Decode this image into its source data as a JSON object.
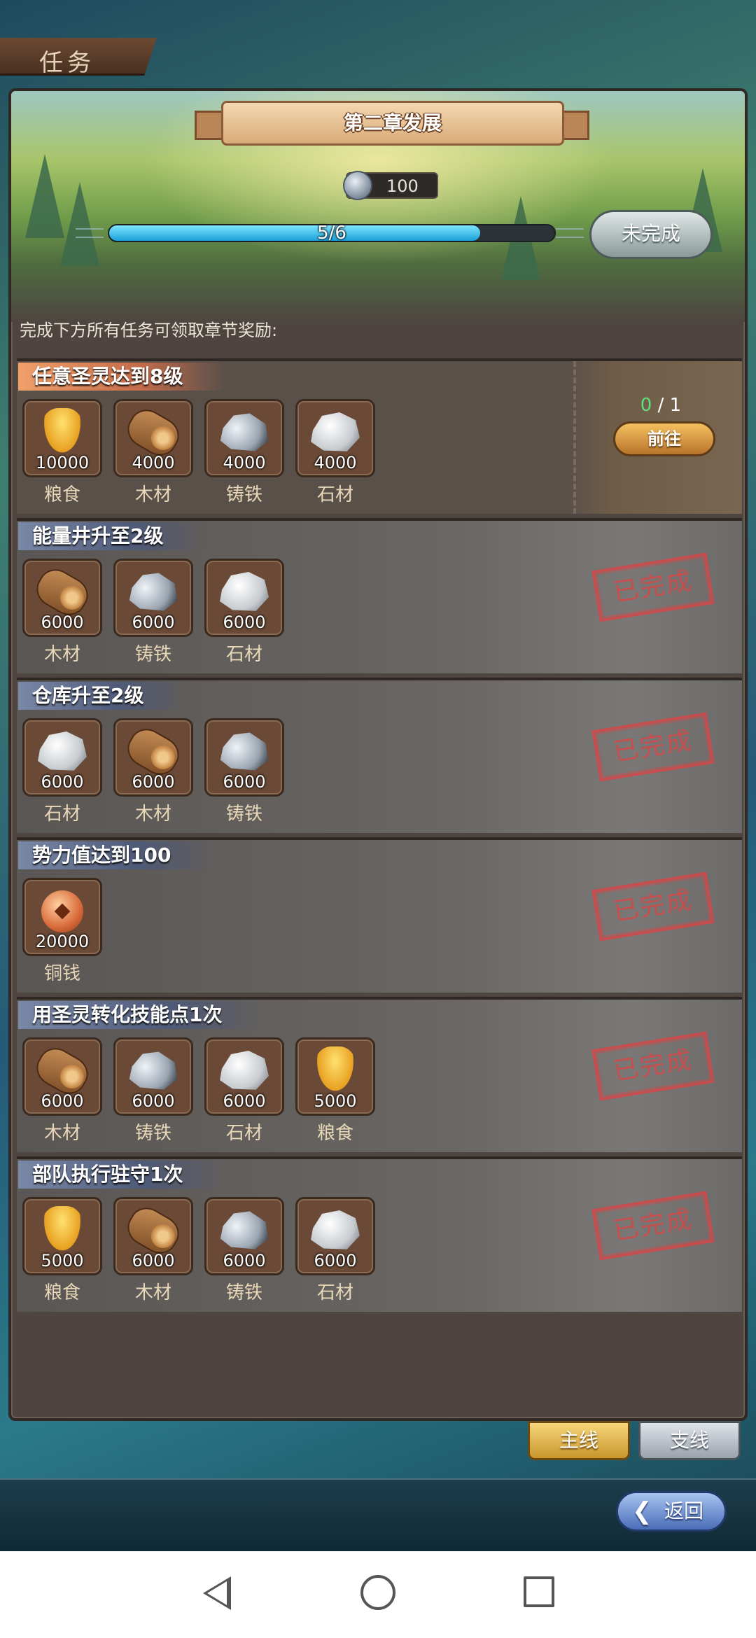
{
  "header": {
    "title": "任务"
  },
  "chapter": {
    "title": "第二章发展",
    "reward_amount": "100",
    "progress_label": "5/6",
    "progress": {
      "current": 5,
      "total": 6
    },
    "status_button": "未完成",
    "hint": "完成下方所有任务可领取章节奖励:"
  },
  "tasks": [
    {
      "title": "任意圣灵达到8级",
      "state": "active",
      "count_current": "0",
      "count_sep": "/",
      "count_total": "1",
      "goto_label": "前往",
      "rewards": [
        {
          "icon": "grain-icon",
          "qty": "10000",
          "name": "粮食"
        },
        {
          "icon": "wood-icon",
          "qty": "4000",
          "name": "木材"
        },
        {
          "icon": "iron-icon",
          "qty": "4000",
          "name": "铸铁"
        },
        {
          "icon": "stone-icon",
          "qty": "4000",
          "name": "石材"
        }
      ]
    },
    {
      "title": "能量井升至2级",
      "state": "done",
      "stamp": "已完成",
      "rewards": [
        {
          "icon": "wood-icon",
          "qty": "6000",
          "name": "木材"
        },
        {
          "icon": "iron-icon",
          "qty": "6000",
          "name": "铸铁"
        },
        {
          "icon": "stone-icon",
          "qty": "6000",
          "name": "石材"
        }
      ]
    },
    {
      "title": "仓库升至2级",
      "state": "done",
      "stamp": "已完成",
      "rewards": [
        {
          "icon": "stone-icon",
          "qty": "6000",
          "name": "石材"
        },
        {
          "icon": "wood-icon",
          "qty": "6000",
          "name": "木材"
        },
        {
          "icon": "iron-icon",
          "qty": "6000",
          "name": "铸铁"
        }
      ]
    },
    {
      "title": "势力值达到100",
      "state": "done",
      "stamp": "已完成",
      "rewards": [
        {
          "icon": "copper-coin-icon",
          "qty": "20000",
          "name": "铜钱"
        }
      ]
    },
    {
      "title": "用圣灵转化技能点1次",
      "state": "done",
      "stamp": "已完成",
      "rewards": [
        {
          "icon": "wood-icon",
          "qty": "6000",
          "name": "木材"
        },
        {
          "icon": "iron-icon",
          "qty": "6000",
          "name": "铸铁"
        },
        {
          "icon": "stone-icon",
          "qty": "6000",
          "name": "石材"
        },
        {
          "icon": "grain-icon",
          "qty": "5000",
          "name": "粮食"
        }
      ]
    },
    {
      "title": "部队执行驻守1次",
      "state": "done",
      "stamp": "已完成",
      "rewards": [
        {
          "icon": "grain-icon",
          "qty": "5000",
          "name": "粮食"
        },
        {
          "icon": "wood-icon",
          "qty": "6000",
          "name": "木材"
        },
        {
          "icon": "iron-icon",
          "qty": "6000",
          "name": "铸铁"
        },
        {
          "icon": "stone-icon",
          "qty": "6000",
          "name": "石材"
        }
      ]
    }
  ],
  "tabs": {
    "main": "主线",
    "side": "支线",
    "selected": "main"
  },
  "back_button": "返回"
}
